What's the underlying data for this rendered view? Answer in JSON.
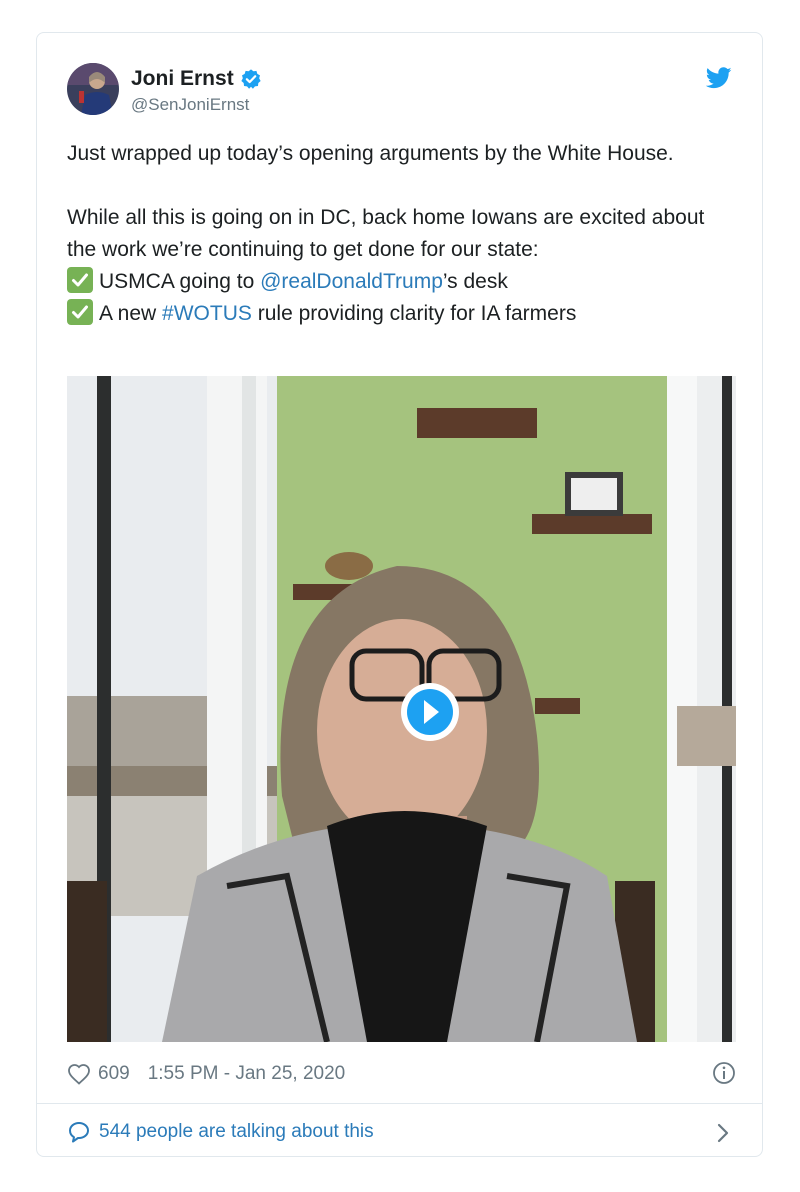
{
  "tweet": {
    "author_name": "Joni Ernst",
    "author_handle": "@SenJoniErnst",
    "verified": true,
    "line1": "Just wrapped up today’s opening arguments by the White House.",
    "line2": "While all this is going on in DC, back home Iowans are excited about the work we’re continuing to get done for our state:",
    "item1_pre": "USMCA going to ",
    "item1_link": "@realDonaldTrump",
    "item1_post": "’s desk",
    "item2_pre": "A new ",
    "item2_link": "#WOTUS",
    "item2_post": " rule providing clarity for IA farmers",
    "checkmark_icon": "check-mark-button-icon"
  },
  "media": {
    "type": "video",
    "play_icon": "play-icon"
  },
  "footer": {
    "like_count": "609",
    "timestamp": "1:55 PM - Jan 25, 2020",
    "talking": "544 people are talking about this"
  },
  "colors": {
    "link": "#2b7bb9",
    "twitter_blue": "#1da1f2",
    "check_green": "#77b255",
    "muted": "#697882"
  }
}
